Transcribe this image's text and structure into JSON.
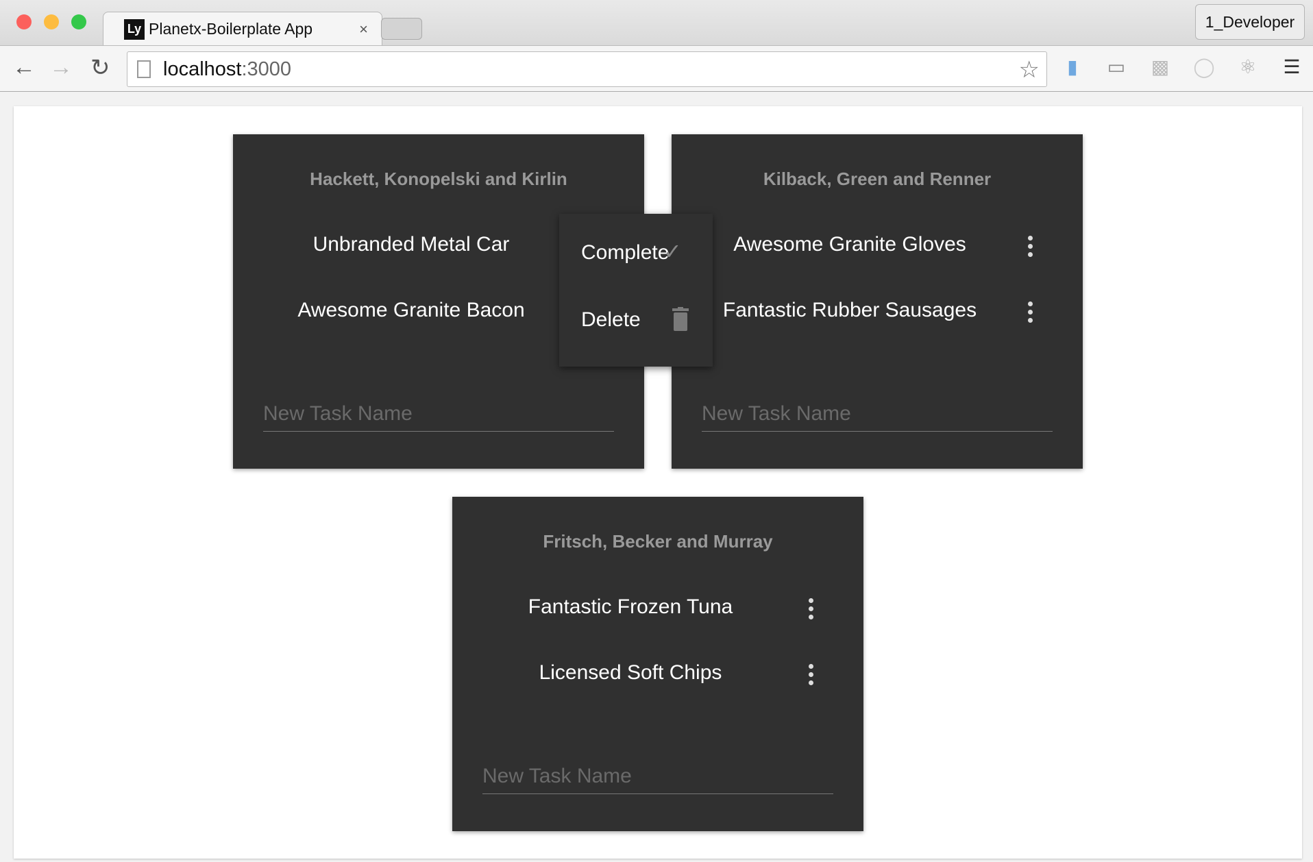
{
  "browser": {
    "tab_title": "Planetx-Boilerplate App",
    "tab_close": "×",
    "favicon": "Ly",
    "profile": "1_Developer",
    "url_host": "localhost",
    "url_port": ":3000",
    "star": "☆"
  },
  "lists": [
    {
      "title": "Hackett, Konopelski and Kirlin",
      "items": [
        "Unbranded Metal Car",
        "Awesome Granite Bacon"
      ],
      "placeholder": "New Task Name"
    },
    {
      "title": "Kilback, Green and Renner",
      "items": [
        "Awesome Granite Gloves",
        "Fantastic Rubber Sausages"
      ],
      "placeholder": "New Task Name"
    },
    {
      "title": "Fritsch, Becker and Murray",
      "items": [
        "Fantastic Frozen Tuna",
        "Licensed Soft Chips"
      ],
      "placeholder": "New Task Name"
    }
  ],
  "menu": {
    "complete": "Complete",
    "delete": "Delete",
    "complete_icon": "✓"
  }
}
